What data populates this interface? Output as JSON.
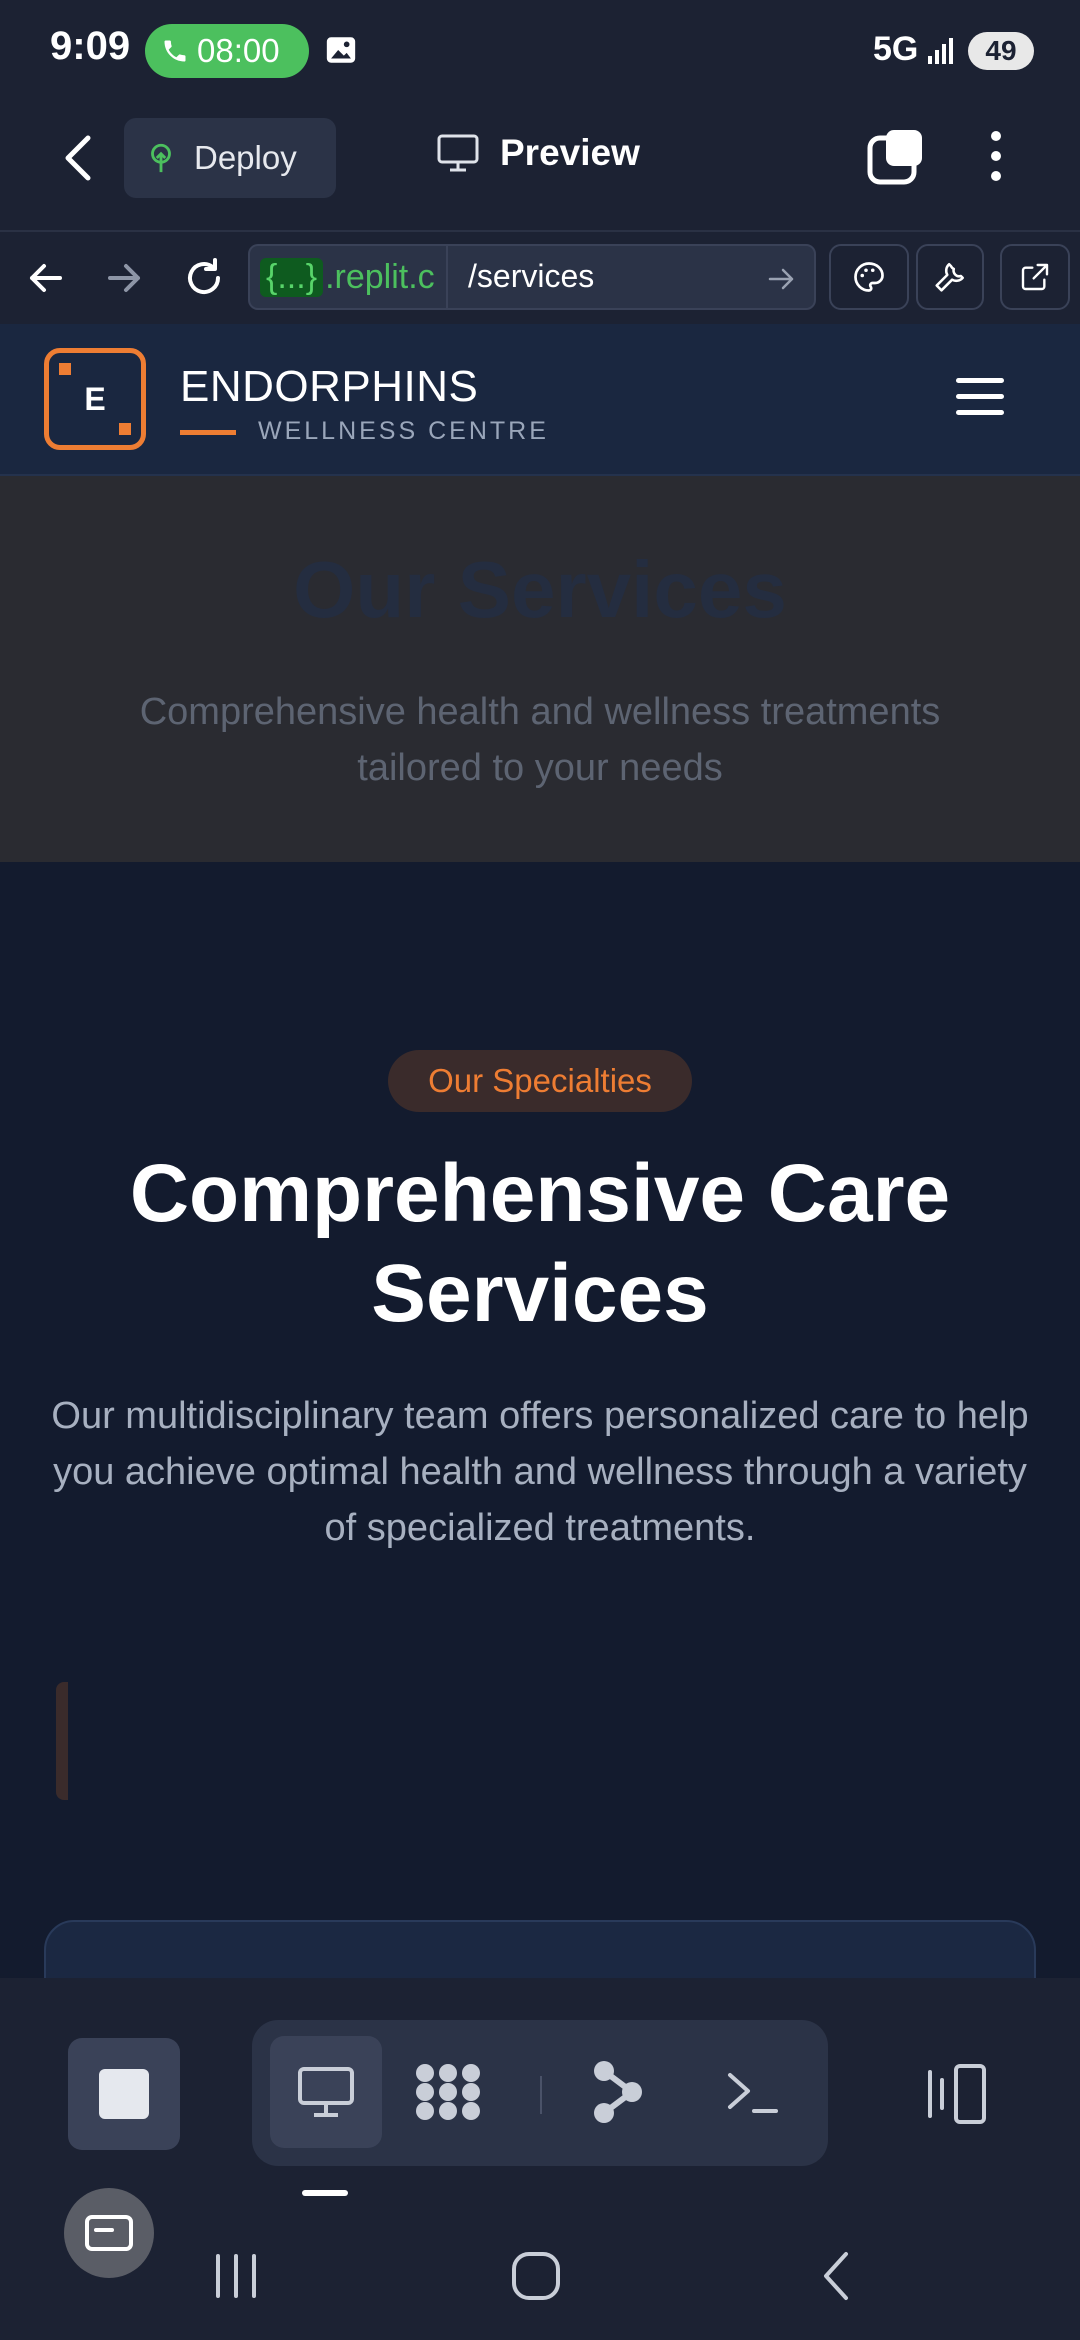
{
  "status_bar": {
    "time": "9:09",
    "call_timer": "08:00",
    "network": "5G",
    "battery": "49"
  },
  "app_header": {
    "deploy_label": "Deploy",
    "preview_label": "Preview"
  },
  "browser": {
    "url_domain_badge": "{...}",
    "url_domain": ".replit.c",
    "url_path": "/services"
  },
  "site": {
    "logo_letter": "E",
    "brand_name": "ENDORPHINS",
    "brand_tagline": "WELLNESS CENTRE",
    "hero_title": "Our Services",
    "hero_subtitle": "Comprehensive health and wellness treatments tailored to your needs",
    "specialties_pill": "Our Specialties",
    "section_title": "Comprehensive Care Services",
    "section_description": "Our multidisciplinary team offers personalized care to help you achieve optimal health and wellness through a variety of specialized treatments."
  },
  "colors": {
    "accent_orange": "#ee7d33",
    "call_green": "#4cc05e",
    "background": "#1c2233"
  },
  "icons": {
    "back": "back-arrow-icon",
    "deploy": "deploy-tree-icon",
    "preview": "monitor-icon",
    "tabs": "tabs-icon",
    "menu": "kebab-menu-icon",
    "browser_back": "arrow-left-icon",
    "browser_forward": "arrow-right-icon",
    "reload": "reload-icon",
    "palette": "palette-icon",
    "devtools": "wrench-icon",
    "external": "external-link-icon"
  }
}
